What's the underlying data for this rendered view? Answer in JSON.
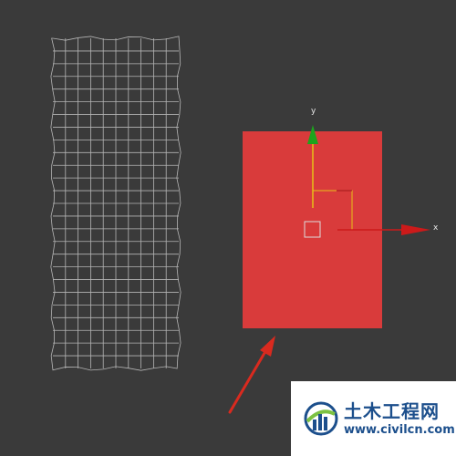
{
  "viewport": {
    "background": "#3a3a3a",
    "wireframe_color": "#b5b5b5",
    "selected_object_color": "#d93b3b",
    "annotation_arrow_color": "#d92a1f"
  },
  "gizmo": {
    "y_label": "y",
    "x_label": "x",
    "y_axis_color": "#1da41d",
    "x_axis_color": "#cc1a1a",
    "plane_handle_color": "#e8c018"
  },
  "watermark": {
    "brand_cn": "土木工程网",
    "url": "www.civilcn.com",
    "logo_icon": "civilcn-logo-icon"
  }
}
